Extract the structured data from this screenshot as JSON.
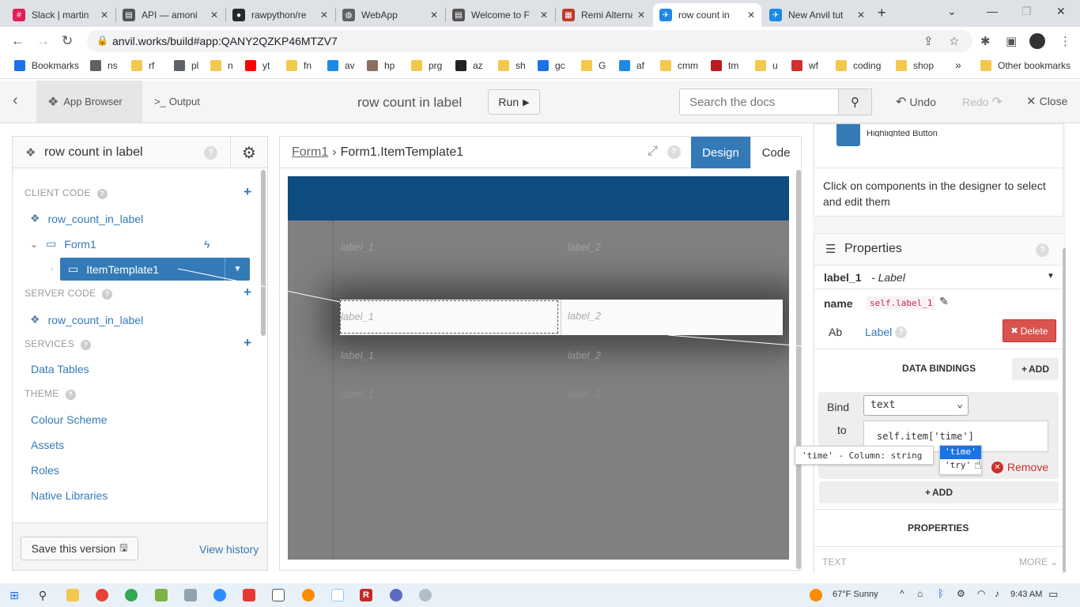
{
  "browser": {
    "tabs": [
      {
        "title": "Slack | martin",
        "fav_color": "#e01e5a",
        "fav_glyph": "#"
      },
      {
        "title": "API — amoni",
        "fav_color": "#555555",
        "fav_glyph": "▤"
      },
      {
        "title": "rawpython/re",
        "fav_color": "#24292e",
        "fav_glyph": "●"
      },
      {
        "title": "WebApp",
        "fav_color": "#5f6368",
        "fav_glyph": "◍"
      },
      {
        "title": "Welcome to F",
        "fav_color": "#555555",
        "fav_glyph": "▤"
      },
      {
        "title": "Remi Alternat",
        "fav_color": "#c0392b",
        "fav_glyph": "▦"
      },
      {
        "title": "row count in",
        "fav_color": "#1e88e5",
        "fav_glyph": "✈"
      },
      {
        "title": "New Anvil tut",
        "fav_color": "#1e88e5",
        "fav_glyph": "✈"
      }
    ],
    "active_tab": 6,
    "url": "anvil.works/build#app:QANY2QZKP46MTZV7",
    "bookmarks": [
      {
        "label": "Bookmarks",
        "color": "#1a73e8"
      },
      {
        "label": "ns",
        "color": "#5f6368"
      },
      {
        "label": "rf",
        "color": "#f2c94c"
      },
      {
        "label": "pl",
        "color": "#5f6368"
      },
      {
        "label": "n",
        "color": "#f2c94c"
      },
      {
        "label": "yt",
        "color": "#ff0000"
      },
      {
        "label": "fn",
        "color": "#f2c94c"
      },
      {
        "label": "av",
        "color": "#1e88e5"
      },
      {
        "label": "hp",
        "color": "#8d6e63"
      },
      {
        "label": "prg",
        "color": "#f2c94c"
      },
      {
        "label": "az",
        "color": "#222222"
      },
      {
        "label": "sh",
        "color": "#f2c94c"
      },
      {
        "label": "gc",
        "color": "#1a73e8"
      },
      {
        "label": "G",
        "color": "#f2c94c"
      },
      {
        "label": "af",
        "color": "#1e88e5"
      },
      {
        "label": "cmm",
        "color": "#f2c94c"
      },
      {
        "label": "tm",
        "color": "#b71c1c"
      },
      {
        "label": "u",
        "color": "#f2c94c"
      },
      {
        "label": "wf",
        "color": "#d32f2f"
      },
      {
        "label": "coding",
        "color": "#f2c94c"
      },
      {
        "label": "shop",
        "color": "#f2c94c"
      }
    ],
    "bookmarks_more": "»",
    "other_bookmarks": "Other bookmarks"
  },
  "toolbar": {
    "app_browser": "App Browser",
    "output": "Output",
    "app_title": "row count in label",
    "run": "Run",
    "search_placeholder": "Search the docs",
    "undo": "Undo",
    "redo": "Redo",
    "close": "Close"
  },
  "left": {
    "app_name": "row count in label",
    "client_code": "CLIENT CODE",
    "client_module": "row_count_in_label",
    "form": "Form1",
    "item_template": "ItemTemplate1",
    "server_code": "SERVER CODE",
    "server_module": "row_count_in_label",
    "services": "SERVICES",
    "data_tables": "Data Tables",
    "theme": "THEME",
    "theme_items": [
      "Colour Scheme",
      "Assets",
      "Roles",
      "Native Libraries"
    ],
    "save": "Save this version",
    "history": "View history"
  },
  "center": {
    "crumb_root": "Form1",
    "crumb_current": "Form1.ItemTemplate1",
    "design_tab": "Design",
    "code_tab": "Code",
    "label1": "label_1",
    "label2": "label_2"
  },
  "right": {
    "cutoff_text": "Highlighted Button",
    "hint": "Click on components in the designer to select and edit them",
    "properties_title": "Properties",
    "component_name": "label_1",
    "component_type": "Label",
    "name_label": "name",
    "name_value": "self.label_1",
    "ab_icon": "Ab",
    "type_link": "Label",
    "delete": "Delete",
    "data_bindings": "DATA BINDINGS",
    "add": "ADD",
    "bind_label": "Bind",
    "to_label": "to",
    "bind_property": "text",
    "bind_expr": "self.item['time']",
    "tooltip": "'time' - Column: string",
    "autocomplete": [
      "'time'",
      "'try'"
    ],
    "remove": "Remove",
    "add2": "ADD",
    "properties_section": "PROPERTIES",
    "text_label": "TEXT",
    "more": "MORE"
  },
  "taskbar": {
    "weather": "67°F Sunny",
    "time": "9:43 AM"
  },
  "colors": {
    "accent": "#337ab7",
    "design_tab_bg": "#337ab7",
    "header_bar": "#0f4c81",
    "delete_red": "#d9534f"
  }
}
